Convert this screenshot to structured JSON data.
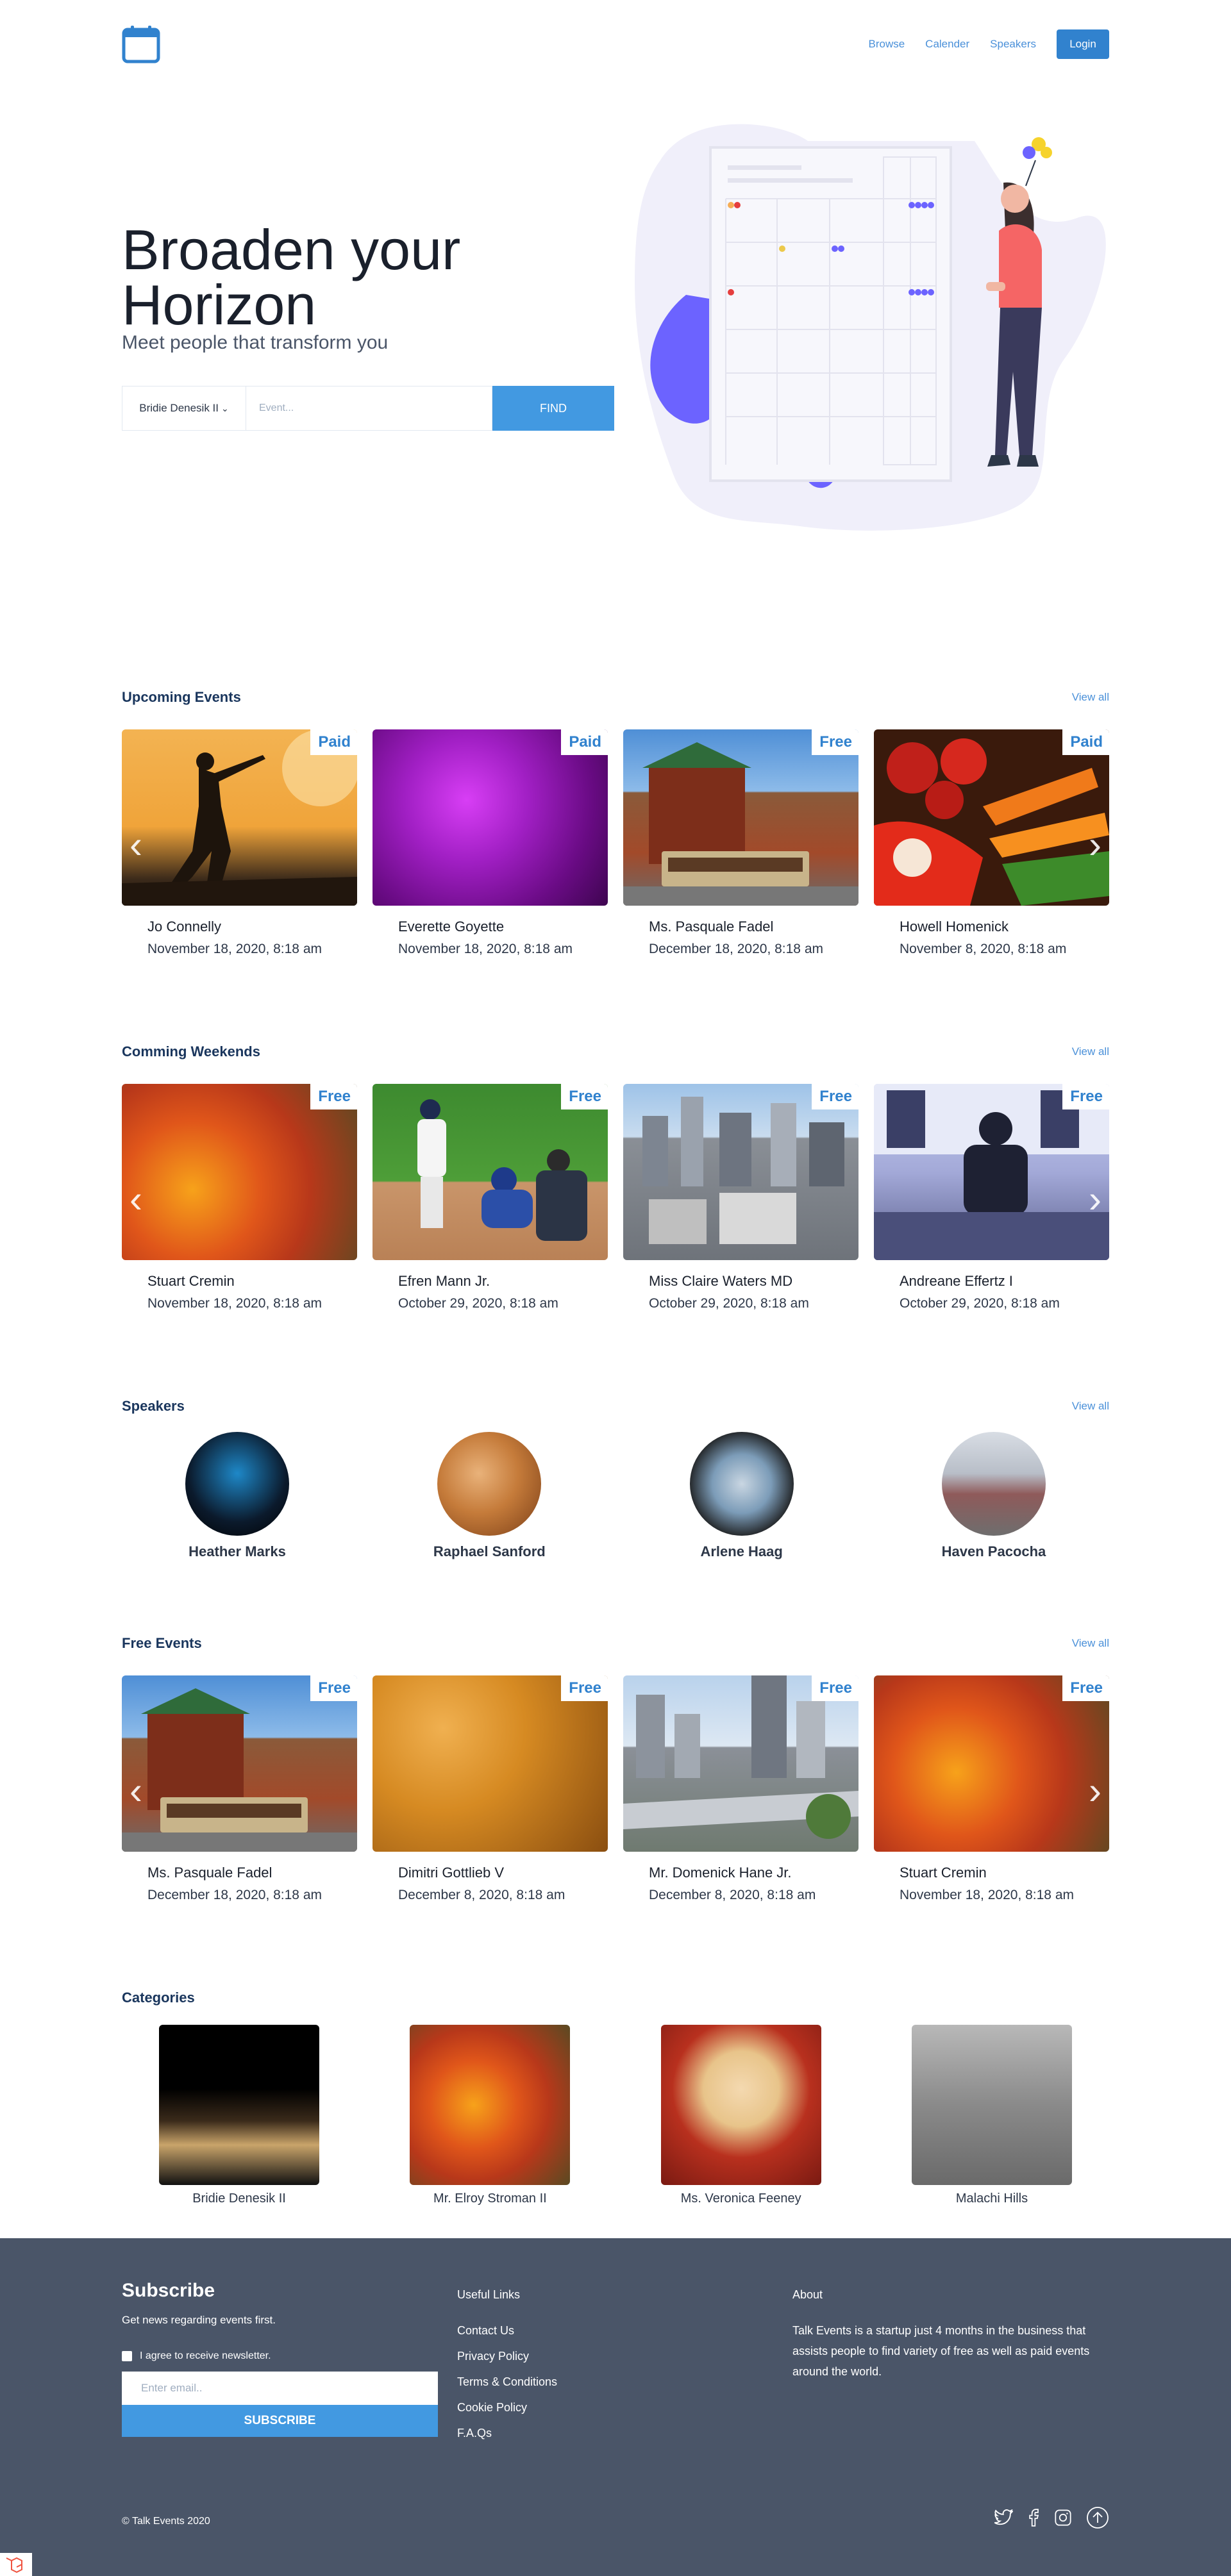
{
  "nav": {
    "links": [
      "Browse",
      "Calender",
      "Speakers"
    ],
    "login": "Login"
  },
  "hero": {
    "title": "Broaden your Horizon",
    "subtitle": "Meet people that transform you",
    "select_value": "Bridie Denesik II",
    "input_placeholder": "Event...",
    "find": "FIND"
  },
  "upcoming": {
    "title": "Upcoming Events",
    "view_all": "View all",
    "cards": [
      {
        "tag": "Paid",
        "name": "Jo Connelly",
        "date": "November 18, 2020, 8:18 am"
      },
      {
        "tag": "Paid",
        "name": "Everette Goyette",
        "date": "November 18, 2020, 8:18 am"
      },
      {
        "tag": "Free",
        "name": "Ms. Pasquale Fadel",
        "date": "December 18, 2020, 8:18 am"
      },
      {
        "tag": "Paid",
        "name": "Howell Homenick",
        "date": "November 8, 2020, 8:18 am"
      }
    ]
  },
  "weekends": {
    "title": "Comming Weekends",
    "view_all": "View all",
    "cards": [
      {
        "tag": "Free",
        "name": "Stuart Cremin",
        "date": "November 18, 2020, 8:18 am"
      },
      {
        "tag": "Free",
        "name": "Efren Mann Jr.",
        "date": "October 29, 2020, 8:18 am"
      },
      {
        "tag": "Free",
        "name": "Miss Claire Waters MD",
        "date": "October 29, 2020, 8:18 am"
      },
      {
        "tag": "Free",
        "name": "Andreane Effertz I",
        "date": "October 29, 2020, 8:18 am"
      }
    ]
  },
  "speakers": {
    "title": "Speakers",
    "view_all": "View all",
    "items": [
      {
        "name": "Heather Marks"
      },
      {
        "name": "Raphael Sanford"
      },
      {
        "name": "Arlene Haag"
      },
      {
        "name": "Haven Pacocha"
      }
    ]
  },
  "free": {
    "title": "Free Events",
    "view_all": "View all",
    "cards": [
      {
        "tag": "Free",
        "name": "Ms. Pasquale Fadel",
        "date": "December 18, 2020, 8:18 am"
      },
      {
        "tag": "Free",
        "name": "Dimitri Gottlieb V",
        "date": "December 8, 2020, 8:18 am"
      },
      {
        "tag": "Free",
        "name": "Mr. Domenick Hane Jr.",
        "date": "December 8, 2020, 8:18 am"
      },
      {
        "tag": "Free",
        "name": "Stuart Cremin",
        "date": "November 18, 2020, 8:18 am"
      }
    ]
  },
  "categories": {
    "title": "Categories",
    "items": [
      {
        "name": "Bridie Denesik II"
      },
      {
        "name": "Mr. Elroy Stroman II"
      },
      {
        "name": "Ms. Veronica Feeney"
      },
      {
        "name": "Malachi Hills"
      }
    ]
  },
  "footer": {
    "subscribe_title": "Subscribe",
    "subscribe_text": "Get news regarding events first.",
    "checkbox_label": "I agree to receive newsletter.",
    "email_placeholder": "Enter email..",
    "subscribe_button": "SUBSCRIBE",
    "links_title": "Useful Links",
    "links": [
      "Contact Us",
      "Privacy Policy",
      "Terms & Conditions",
      "Cookie Policy",
      "F.A.Qs"
    ],
    "about_title": "About",
    "about_text": "Talk Events is a startup just 4 months in the business that assists people to find variety of free as well as paid events around the world.",
    "copyright": "© Talk Events 2020"
  },
  "colors": {
    "accent": "#3182ce",
    "footer_bg": "#4a5568",
    "illustration_purple": "#6c63ff"
  },
  "icons": [
    "calendar-icon",
    "chevron-down-icon",
    "chevron-left-icon",
    "chevron-right-icon",
    "twitter-icon",
    "facebook-icon",
    "instagram-icon",
    "arrow-up-icon"
  ]
}
